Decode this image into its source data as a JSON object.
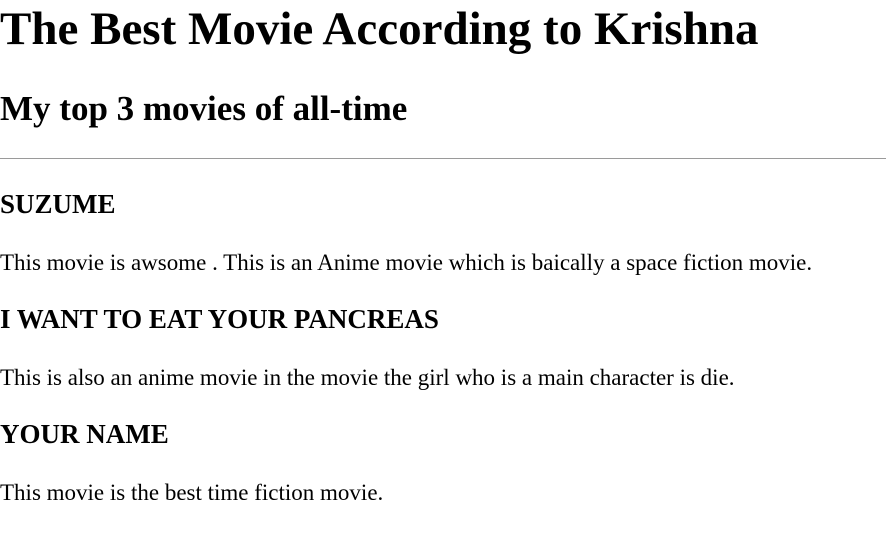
{
  "page": {
    "title": "The Best Movie According to Krishna",
    "subtitle": "My top 3 movies of all-time"
  },
  "movies": [
    {
      "title": "SUZUME",
      "description": "This movie is awsome . This is an Anime movie which is baically a space fiction movie."
    },
    {
      "title": "I WANT TO EAT YOUR PANCREAS",
      "description": "This is also an anime movie in the movie the girl who is a main character is die."
    },
    {
      "title": "YOUR NAME",
      "description": "This movie is the best time fiction movie."
    }
  ]
}
